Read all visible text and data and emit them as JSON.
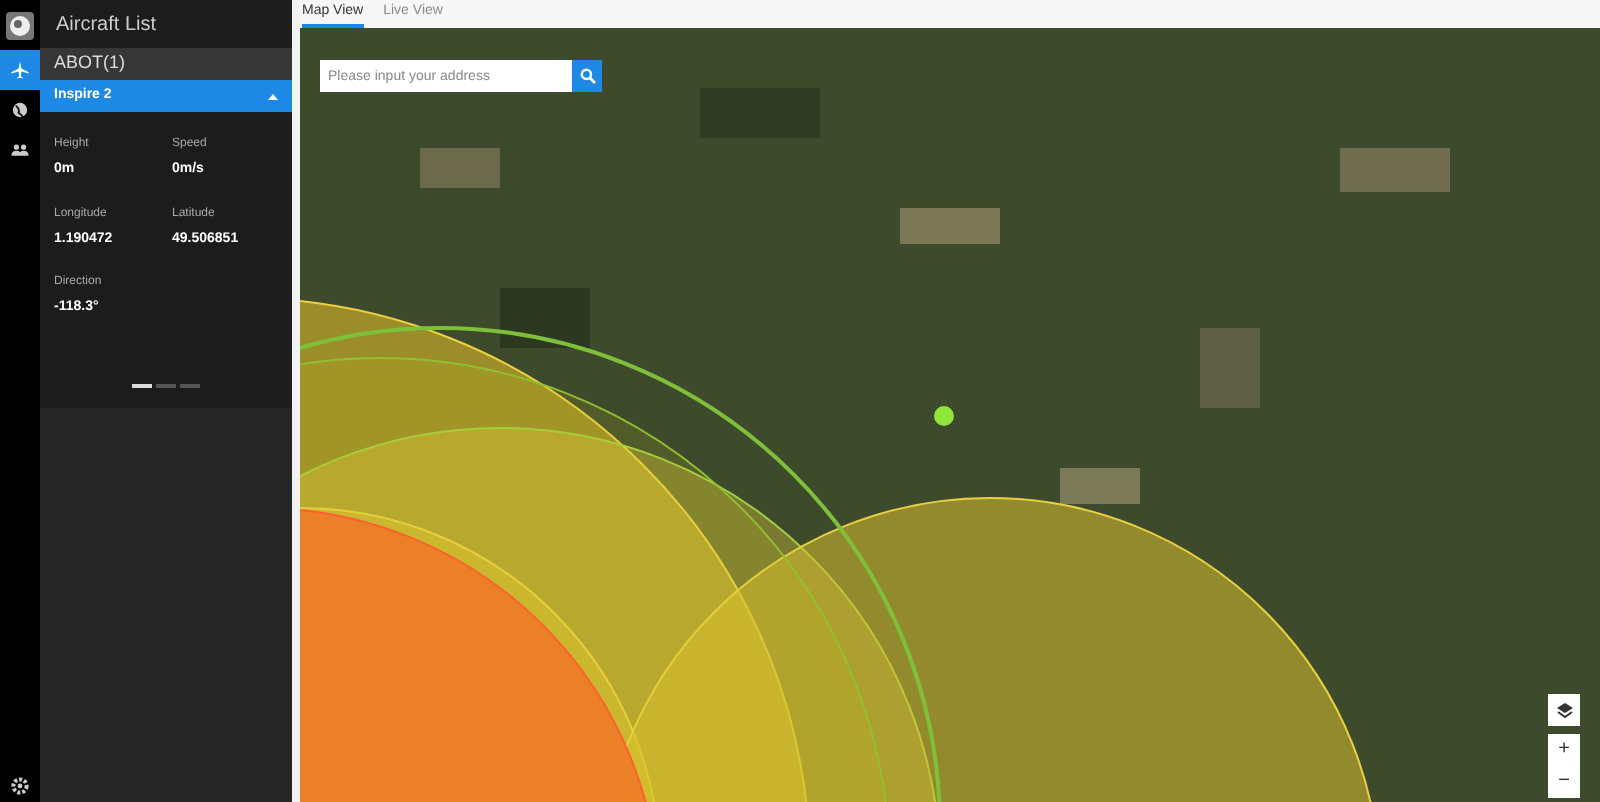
{
  "nav": [
    {
      "kind": "plane",
      "selected": true
    },
    {
      "kind": "globe",
      "selected": false
    },
    {
      "kind": "people",
      "selected": false
    }
  ],
  "panel": {
    "title": "Aircraft List",
    "group": "ABOT(1)",
    "aircraft": {
      "name": "Inspire 2",
      "expanded": true
    },
    "fields": [
      {
        "label": "Height",
        "value": "0m"
      },
      {
        "label": "Speed",
        "value": "0m/s"
      },
      {
        "label": "Longitude",
        "value": "1.190472"
      },
      {
        "label": "Latitude",
        "value": "49.506851"
      },
      {
        "label": "Direction",
        "value": "-118.3°"
      }
    ],
    "pages": [
      {
        "selected": true
      },
      {
        "selected": false
      },
      {
        "selected": false
      }
    ]
  },
  "tabs": [
    {
      "label": "Map View",
      "selected": true
    },
    {
      "label": "Live View",
      "selected": false
    }
  ],
  "search": {
    "placeholder": "Please input your address"
  },
  "map_controls": {
    "zoom_in": "+",
    "zoom_out": "−"
  }
}
